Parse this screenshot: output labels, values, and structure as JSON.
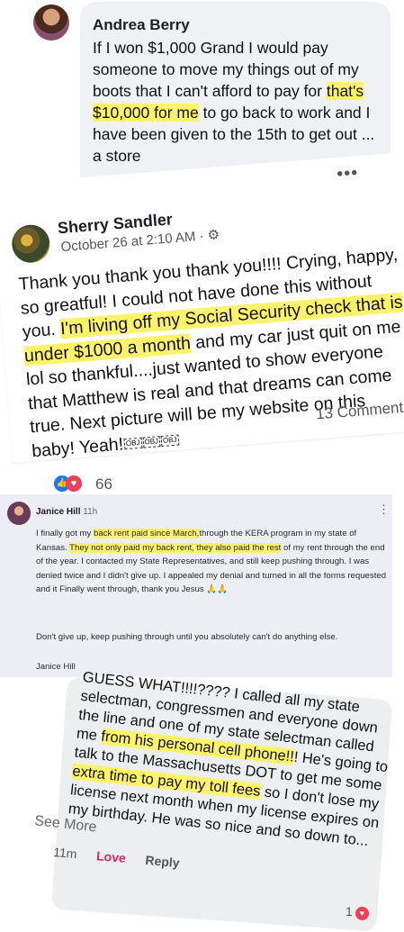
{
  "post1": {
    "name": "Andrea Berry",
    "text_a": "If I won $1,000 Grand I would pay someone to move my things out of my boots that I can't afford to pay for ",
    "highlight": "that's $10,000 for me",
    "text_b": " to go back to work and I have been given to the 15th to get out ... a store"
  },
  "post2": {
    "name": "Sherry Sandler",
    "date": "October 26 at 2:10 AM · ⚙",
    "more": "•••",
    "text_a": "Thank you thank you thank you!!!! Crying, happy, so greatful! I could not have done this without you. ",
    "highlight": "I'm living off my Social Security check that is under $1000 a month",
    "text_b": " and my car just quit on me lol so thankful....just wanted to show everyone that Matthew is real and that dreams can come true. Next picture will be my website on this baby! Yeah!",
    "obj": "OBJ",
    "comments": "13 Comment",
    "reaction_count": "66"
  },
  "post3": {
    "name": "Janice Hill",
    "time": "11h",
    "text_a": "I finally got my ",
    "hl1": "back rent paid since March,",
    "text_b": "through the KERA program in my state of Kansas. ",
    "hl2": "They not only paid my back rent, they also paid the rest",
    "text_c": " of my rent through the end of the year. I contacted my State Representatives, and still keep pushing through. I was denied twice and I didn't give up. I appealed my denial and turned in all the forms requested and it Finally went through, thank you Jesus 🙏🙏",
    "p2": "Don't give up, keep pushing through until you absolutely can't do anything else.",
    "p3": "Janice Hill"
  },
  "post4": {
    "text_a": "GUESS WHAT!!!!???? I called all my state selectman, congressmen and everyone down the line and one of my state selectman called me ",
    "hl1": "from his personal cell phone!!",
    "text_b": "! He's going to talk to the Massachusetts DOT to get me some ",
    "hl2": "extra time to pay my toll fees",
    "text_c": " so I don't lose my license next month when my license expires on my birthday.  He was so nice and so down to...",
    "see_more": "See More",
    "time": "11m",
    "love": "Love",
    "reply": "Reply",
    "reaction_count": "1"
  }
}
